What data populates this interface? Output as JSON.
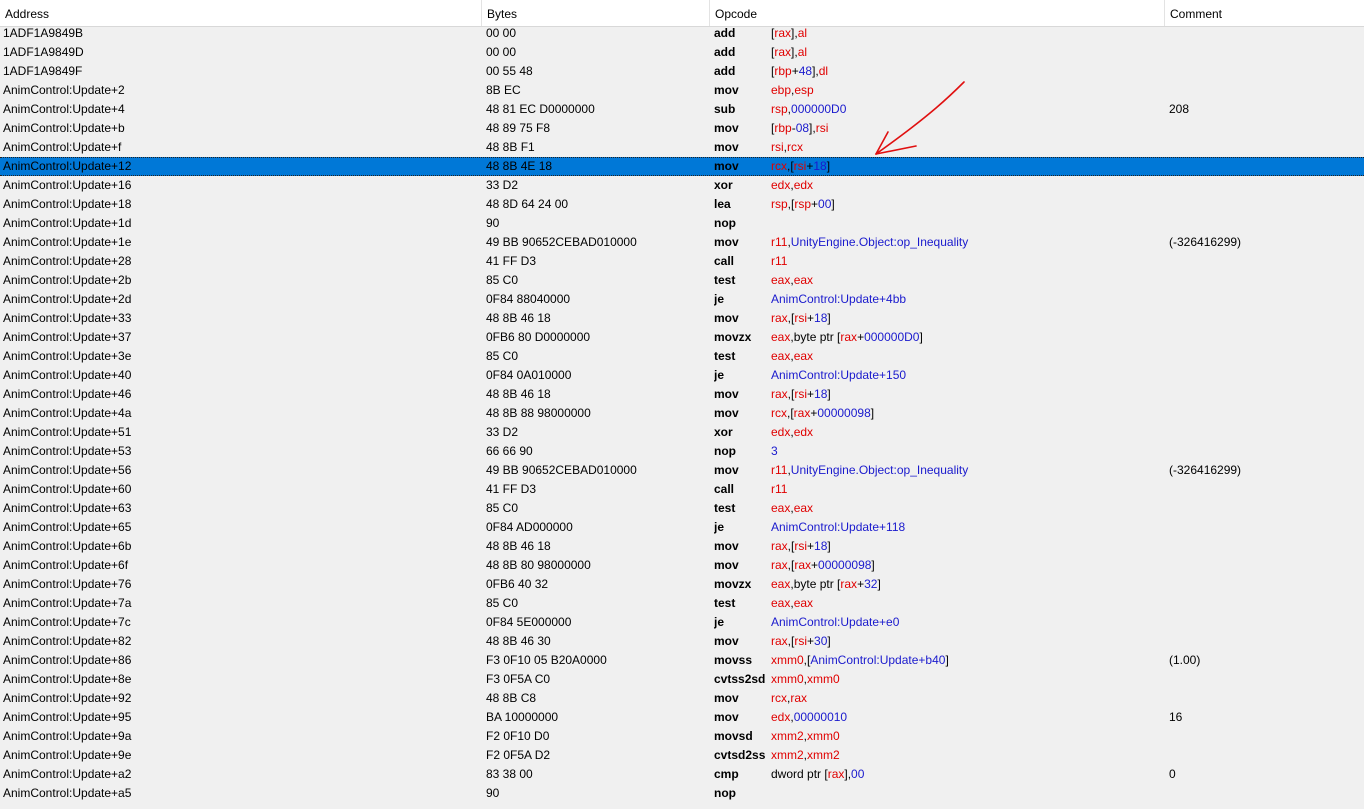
{
  "columns": {
    "address": "Address",
    "bytes": "Bytes",
    "opcode": "Opcode",
    "comment": "Comment"
  },
  "colors": {
    "register": "#e00000",
    "constant": "#1a1acd",
    "selection": "#0078d7",
    "annotation_arrow": "#e01010"
  },
  "annotation": {
    "icon": "red-arrow-icon",
    "points_to_row": 7
  },
  "rows": [
    {
      "address": "1ADF1A9849B",
      "bytes": "00 00",
      "mnemonic": "add",
      "args": [
        [
          "[",
          "k"
        ],
        [
          "rax",
          "r"
        ],
        [
          "],",
          "k"
        ],
        [
          "al",
          "r"
        ]
      ],
      "comment": ""
    },
    {
      "address": "1ADF1A9849D",
      "bytes": "00 00",
      "mnemonic": "add",
      "args": [
        [
          "[",
          "k"
        ],
        [
          "rax",
          "r"
        ],
        [
          "],",
          "k"
        ],
        [
          "al",
          "r"
        ]
      ],
      "comment": ""
    },
    {
      "address": "1ADF1A9849F",
      "bytes": "00 55 48",
      "mnemonic": "add",
      "args": [
        [
          "[",
          "k"
        ],
        [
          "rbp",
          "r"
        ],
        [
          "+",
          "k"
        ],
        [
          "48",
          "b"
        ],
        [
          "],",
          "k"
        ],
        [
          "dl",
          "r"
        ]
      ],
      "comment": ""
    },
    {
      "address": "AnimControl:Update+2",
      "bytes": "8B EC",
      "mnemonic": "mov",
      "args": [
        [
          "ebp",
          "r"
        ],
        [
          ",",
          "k"
        ],
        [
          "esp",
          "r"
        ]
      ],
      "comment": ""
    },
    {
      "address": "AnimControl:Update+4",
      "bytes": "48 81 EC D0000000",
      "mnemonic": "sub",
      "args": [
        [
          "rsp",
          "r"
        ],
        [
          ",",
          "k"
        ],
        [
          "000000D0",
          "b"
        ]
      ],
      "comment": "208"
    },
    {
      "address": "AnimControl:Update+b",
      "bytes": "48 89 75 F8",
      "mnemonic": "mov",
      "args": [
        [
          "[",
          "k"
        ],
        [
          "rbp",
          "r"
        ],
        [
          "-",
          "k"
        ],
        [
          "08",
          "b"
        ],
        [
          "],",
          "k"
        ],
        [
          "rsi",
          "r"
        ]
      ],
      "comment": ""
    },
    {
      "address": "AnimControl:Update+f",
      "bytes": "48 8B F1",
      "mnemonic": "mov",
      "args": [
        [
          "rsi",
          "r"
        ],
        [
          ",",
          "k"
        ],
        [
          "rcx",
          "r"
        ]
      ],
      "comment": ""
    },
    {
      "address": "AnimControl:Update+12",
      "bytes": "48 8B 4E 18",
      "mnemonic": "mov",
      "args": [
        [
          "rcx",
          "r"
        ],
        [
          ",[",
          "k"
        ],
        [
          "rsi",
          "r"
        ],
        [
          "+",
          "k"
        ],
        [
          "18",
          "b"
        ],
        [
          "]",
          "k"
        ]
      ],
      "comment": "",
      "selected": true
    },
    {
      "address": "AnimControl:Update+16",
      "bytes": "33 D2",
      "mnemonic": "xor",
      "args": [
        [
          "edx",
          "r"
        ],
        [
          ",",
          "k"
        ],
        [
          "edx",
          "r"
        ]
      ],
      "comment": ""
    },
    {
      "address": "AnimControl:Update+18",
      "bytes": "48 8D 64 24 00",
      "mnemonic": "lea",
      "args": [
        [
          "rsp",
          "r"
        ],
        [
          ",[",
          "k"
        ],
        [
          "rsp",
          "r"
        ],
        [
          "+",
          "k"
        ],
        [
          "00",
          "b"
        ],
        [
          "]",
          "k"
        ]
      ],
      "comment": ""
    },
    {
      "address": "AnimControl:Update+1d",
      "bytes": "90",
      "mnemonic": "nop",
      "args": [],
      "comment": ""
    },
    {
      "address": "AnimControl:Update+1e",
      "bytes": "49 BB 90652CEBAD010000",
      "mnemonic": "mov",
      "args": [
        [
          "r11",
          "r"
        ],
        [
          ",",
          "k"
        ],
        [
          "UnityEngine.Object:op_Inequality",
          "b"
        ]
      ],
      "comment": "(-326416299)"
    },
    {
      "address": "AnimControl:Update+28",
      "bytes": "41 FF D3",
      "mnemonic": "call",
      "args": [
        [
          "r11",
          "r"
        ]
      ],
      "comment": ""
    },
    {
      "address": "AnimControl:Update+2b",
      "bytes": "85 C0",
      "mnemonic": "test",
      "args": [
        [
          "eax",
          "r"
        ],
        [
          ",",
          "k"
        ],
        [
          "eax",
          "r"
        ]
      ],
      "comment": ""
    },
    {
      "address": "AnimControl:Update+2d",
      "bytes": "0F84 88040000",
      "mnemonic": "je",
      "args": [
        [
          "AnimControl:Update+4bb",
          "b"
        ]
      ],
      "comment": ""
    },
    {
      "address": "AnimControl:Update+33",
      "bytes": "48 8B 46 18",
      "mnemonic": "mov",
      "args": [
        [
          "rax",
          "r"
        ],
        [
          ",[",
          "k"
        ],
        [
          "rsi",
          "r"
        ],
        [
          "+",
          "k"
        ],
        [
          "18",
          "b"
        ],
        [
          "]",
          "k"
        ]
      ],
      "comment": ""
    },
    {
      "address": "AnimControl:Update+37",
      "bytes": "0FB6 80 D0000000",
      "mnemonic": "movzx",
      "args": [
        [
          "eax",
          "r"
        ],
        [
          ",byte ptr [",
          "k"
        ],
        [
          "rax",
          "r"
        ],
        [
          "+",
          "k"
        ],
        [
          "000000D0",
          "b"
        ],
        [
          "]",
          "k"
        ]
      ],
      "comment": ""
    },
    {
      "address": "AnimControl:Update+3e",
      "bytes": "85 C0",
      "mnemonic": "test",
      "args": [
        [
          "eax",
          "r"
        ],
        [
          ",",
          "k"
        ],
        [
          "eax",
          "r"
        ]
      ],
      "comment": ""
    },
    {
      "address": "AnimControl:Update+40",
      "bytes": "0F84 0A010000",
      "mnemonic": "je",
      "args": [
        [
          "AnimControl:Update+150",
          "b"
        ]
      ],
      "comment": ""
    },
    {
      "address": "AnimControl:Update+46",
      "bytes": "48 8B 46 18",
      "mnemonic": "mov",
      "args": [
        [
          "rax",
          "r"
        ],
        [
          ",[",
          "k"
        ],
        [
          "rsi",
          "r"
        ],
        [
          "+",
          "k"
        ],
        [
          "18",
          "b"
        ],
        [
          "]",
          "k"
        ]
      ],
      "comment": ""
    },
    {
      "address": "AnimControl:Update+4a",
      "bytes": "48 8B 88 98000000",
      "mnemonic": "mov",
      "args": [
        [
          "rcx",
          "r"
        ],
        [
          ",[",
          "k"
        ],
        [
          "rax",
          "r"
        ],
        [
          "+",
          "k"
        ],
        [
          "00000098",
          "b"
        ],
        [
          "]",
          "k"
        ]
      ],
      "comment": ""
    },
    {
      "address": "AnimControl:Update+51",
      "bytes": "33 D2",
      "mnemonic": "xor",
      "args": [
        [
          "edx",
          "r"
        ],
        [
          ",",
          "k"
        ],
        [
          "edx",
          "r"
        ]
      ],
      "comment": ""
    },
    {
      "address": "AnimControl:Update+53",
      "bytes": "66 66 90",
      "mnemonic": "nop",
      "args": [
        [
          "3",
          "b"
        ]
      ],
      "comment": ""
    },
    {
      "address": "AnimControl:Update+56",
      "bytes": "49 BB 90652CEBAD010000",
      "mnemonic": "mov",
      "args": [
        [
          "r11",
          "r"
        ],
        [
          ",",
          "k"
        ],
        [
          "UnityEngine.Object:op_Inequality",
          "b"
        ]
      ],
      "comment": "(-326416299)"
    },
    {
      "address": "AnimControl:Update+60",
      "bytes": "41 FF D3",
      "mnemonic": "call",
      "args": [
        [
          "r11",
          "r"
        ]
      ],
      "comment": ""
    },
    {
      "address": "AnimControl:Update+63",
      "bytes": "85 C0",
      "mnemonic": "test",
      "args": [
        [
          "eax",
          "r"
        ],
        [
          ",",
          "k"
        ],
        [
          "eax",
          "r"
        ]
      ],
      "comment": ""
    },
    {
      "address": "AnimControl:Update+65",
      "bytes": "0F84 AD000000",
      "mnemonic": "je",
      "args": [
        [
          "AnimControl:Update+118",
          "b"
        ]
      ],
      "comment": ""
    },
    {
      "address": "AnimControl:Update+6b",
      "bytes": "48 8B 46 18",
      "mnemonic": "mov",
      "args": [
        [
          "rax",
          "r"
        ],
        [
          ",[",
          "k"
        ],
        [
          "rsi",
          "r"
        ],
        [
          "+",
          "k"
        ],
        [
          "18",
          "b"
        ],
        [
          "]",
          "k"
        ]
      ],
      "comment": ""
    },
    {
      "address": "AnimControl:Update+6f",
      "bytes": "48 8B 80 98000000",
      "mnemonic": "mov",
      "args": [
        [
          "rax",
          "r"
        ],
        [
          ",[",
          "k"
        ],
        [
          "rax",
          "r"
        ],
        [
          "+",
          "k"
        ],
        [
          "00000098",
          "b"
        ],
        [
          "]",
          "k"
        ]
      ],
      "comment": ""
    },
    {
      "address": "AnimControl:Update+76",
      "bytes": "0FB6 40 32",
      "mnemonic": "movzx",
      "args": [
        [
          "eax",
          "r"
        ],
        [
          ",byte ptr [",
          "k"
        ],
        [
          "rax",
          "r"
        ],
        [
          "+",
          "k"
        ],
        [
          "32",
          "b"
        ],
        [
          "]",
          "k"
        ]
      ],
      "comment": ""
    },
    {
      "address": "AnimControl:Update+7a",
      "bytes": "85 C0",
      "mnemonic": "test",
      "args": [
        [
          "eax",
          "r"
        ],
        [
          ",",
          "k"
        ],
        [
          "eax",
          "r"
        ]
      ],
      "comment": ""
    },
    {
      "address": "AnimControl:Update+7c",
      "bytes": "0F84 5E000000",
      "mnemonic": "je",
      "args": [
        [
          "AnimControl:Update+e0",
          "b"
        ]
      ],
      "comment": ""
    },
    {
      "address": "AnimControl:Update+82",
      "bytes": "48 8B 46 30",
      "mnemonic": "mov",
      "args": [
        [
          "rax",
          "r"
        ],
        [
          ",[",
          "k"
        ],
        [
          "rsi",
          "r"
        ],
        [
          "+",
          "k"
        ],
        [
          "30",
          "b"
        ],
        [
          "]",
          "k"
        ]
      ],
      "comment": ""
    },
    {
      "address": "AnimControl:Update+86",
      "bytes": "F3 0F10 05 B20A0000",
      "mnemonic": "movss",
      "args": [
        [
          "xmm0",
          "r"
        ],
        [
          ",[",
          "k"
        ],
        [
          "AnimControl:Update+b40",
          "b"
        ],
        [
          "]",
          "k"
        ]
      ],
      "comment": "(1.00)"
    },
    {
      "address": "AnimControl:Update+8e",
      "bytes": "F3 0F5A C0",
      "mnemonic": "cvtss2sd",
      "args": [
        [
          "xmm0",
          "r"
        ],
        [
          ",",
          "k"
        ],
        [
          "xmm0",
          "r"
        ]
      ],
      "comment": ""
    },
    {
      "address": "AnimControl:Update+92",
      "bytes": "48 8B C8",
      "mnemonic": "mov",
      "args": [
        [
          "rcx",
          "r"
        ],
        [
          ",",
          "k"
        ],
        [
          "rax",
          "r"
        ]
      ],
      "comment": ""
    },
    {
      "address": "AnimControl:Update+95",
      "bytes": "BA 10000000",
      "mnemonic": "mov",
      "args": [
        [
          "edx",
          "r"
        ],
        [
          ",",
          "k"
        ],
        [
          "00000010",
          "b"
        ]
      ],
      "comment": "16"
    },
    {
      "address": "AnimControl:Update+9a",
      "bytes": "F2 0F10 D0",
      "mnemonic": "movsd",
      "args": [
        [
          "xmm2",
          "r"
        ],
        [
          ",",
          "k"
        ],
        [
          "xmm0",
          "r"
        ]
      ],
      "comment": ""
    },
    {
      "address": "AnimControl:Update+9e",
      "bytes": "F2 0F5A D2",
      "mnemonic": "cvtsd2ss",
      "args": [
        [
          "xmm2",
          "r"
        ],
        [
          ",",
          "k"
        ],
        [
          "xmm2",
          "r"
        ]
      ],
      "comment": ""
    },
    {
      "address": "AnimControl:Update+a2",
      "bytes": "83 38 00",
      "mnemonic": "cmp",
      "args": [
        [
          "dword ptr [",
          "k"
        ],
        [
          "rax",
          "r"
        ],
        [
          "],",
          "k"
        ],
        [
          "00",
          "b"
        ]
      ],
      "comment": "0"
    },
    {
      "address": "AnimControl:Update+a5",
      "bytes": "90",
      "mnemonic": "nop",
      "args": [],
      "comment": ""
    }
  ]
}
